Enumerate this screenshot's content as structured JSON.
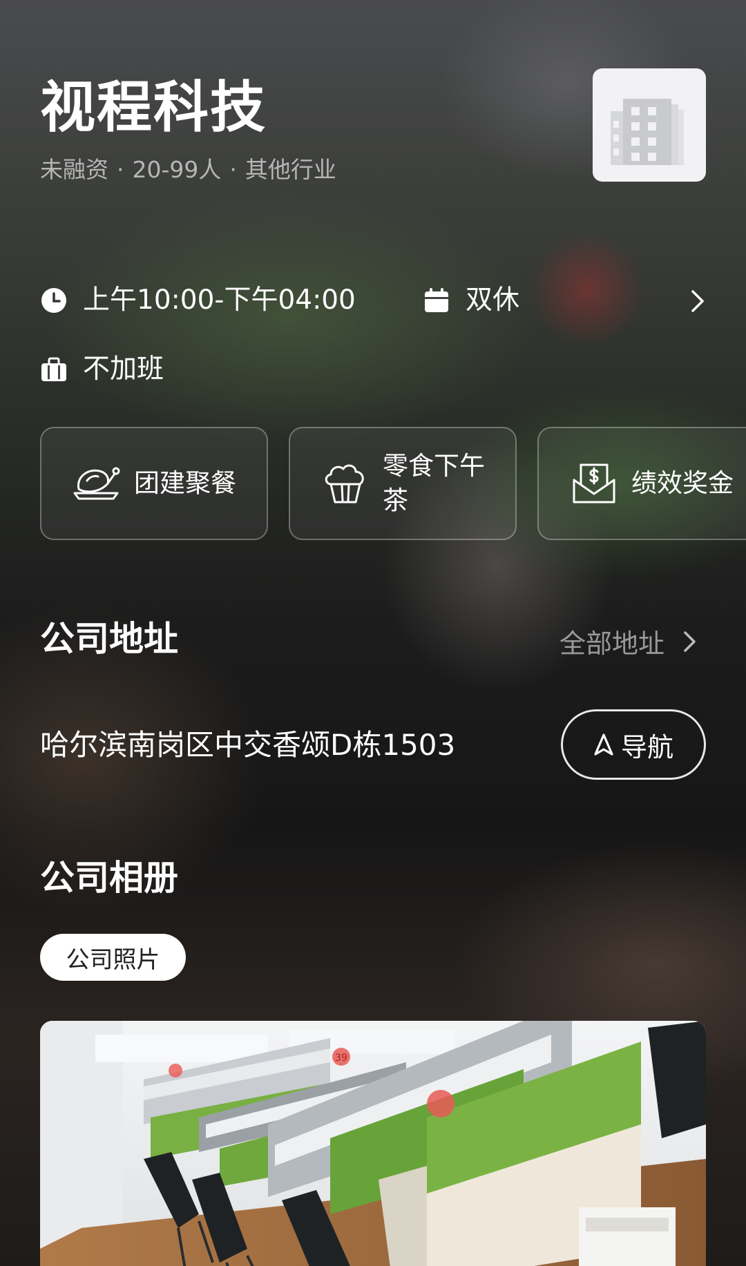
{
  "company": {
    "name": "视程科技",
    "meta": [
      "未融资",
      "20-99人",
      "其他行业"
    ],
    "separator": "·"
  },
  "hours": {
    "work_time": "上午10:00-下午04:00",
    "rest": "双休",
    "overtime": "不加班"
  },
  "welfare": [
    {
      "icon": "roast-chicken-icon",
      "label": "团建聚餐"
    },
    {
      "icon": "cupcake-icon",
      "label": "零食下午茶"
    },
    {
      "icon": "bonus-envelope-icon",
      "label": "绩效奖金"
    }
  ],
  "address_section": {
    "title": "公司地址",
    "all_link": "全部地址",
    "address": "哈尔滨南岗区中交香颂D栋1503",
    "nav_label": "导航"
  },
  "album": {
    "title": "公司相册",
    "chip_label": "公司照片",
    "photo_marks": [
      "39"
    ]
  },
  "colors": {
    "text_primary": "#ffffff",
    "text_secondary": "#9a9a9a",
    "chip_bg": "#ffffff"
  }
}
